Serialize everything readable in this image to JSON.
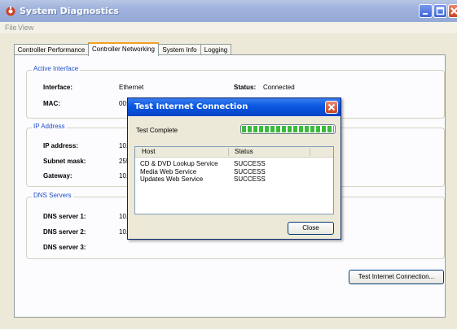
{
  "window": {
    "title": "System Diagnostics",
    "icon": "gear-icon"
  },
  "menu": [
    "File",
    "View"
  ],
  "tabs": [
    {
      "label": "Controller Performance",
      "active": false
    },
    {
      "label": "Controller Networking",
      "active": true
    },
    {
      "label": "System Info",
      "active": false
    },
    {
      "label": "Logging",
      "active": false
    }
  ],
  "active_interface": {
    "title": "Active Interface",
    "interface_label": "Interface:",
    "interface_value": "Ethernet",
    "status_label": "Status:",
    "status_value": "Connected",
    "mac_label": "MAC:",
    "mac_value": "00:"
  },
  "ip_address": {
    "title": "IP Address",
    "ip_label": "IP address:",
    "ip_value": "10.",
    "subnet_label": "Subnet mask:",
    "subnet_value": "255",
    "gateway_label": "Gateway:",
    "gateway_value": "10."
  },
  "dns": {
    "title": "DNS Servers",
    "dns1_label": "DNS server 1:",
    "dns1_value": "10.",
    "dns2_label": "DNS server 2:",
    "dns2_value": "10.",
    "dns3_label": "DNS server 3:"
  },
  "test_button_label": "Test Internet Connection...",
  "dialog": {
    "title": "Test Internet Connection",
    "status": "Test Complete",
    "progress": 1.0,
    "columns": [
      "Host",
      "Status"
    ],
    "rows": [
      {
        "host": "CD & DVD Lookup Service",
        "status": "SUCCESS"
      },
      {
        "host": "Media Web Service",
        "status": "SUCCESS"
      },
      {
        "host": "Updates Web Service",
        "status": "SUCCESS"
      }
    ],
    "close_label": "Close"
  },
  "colors": {
    "titlebar": "#9fb2dd",
    "dialog_titlebar": "#0a57e2",
    "group_title": "#1f4fc8",
    "progress": "#3cba3c",
    "tab_highlight": "#f0a020"
  }
}
